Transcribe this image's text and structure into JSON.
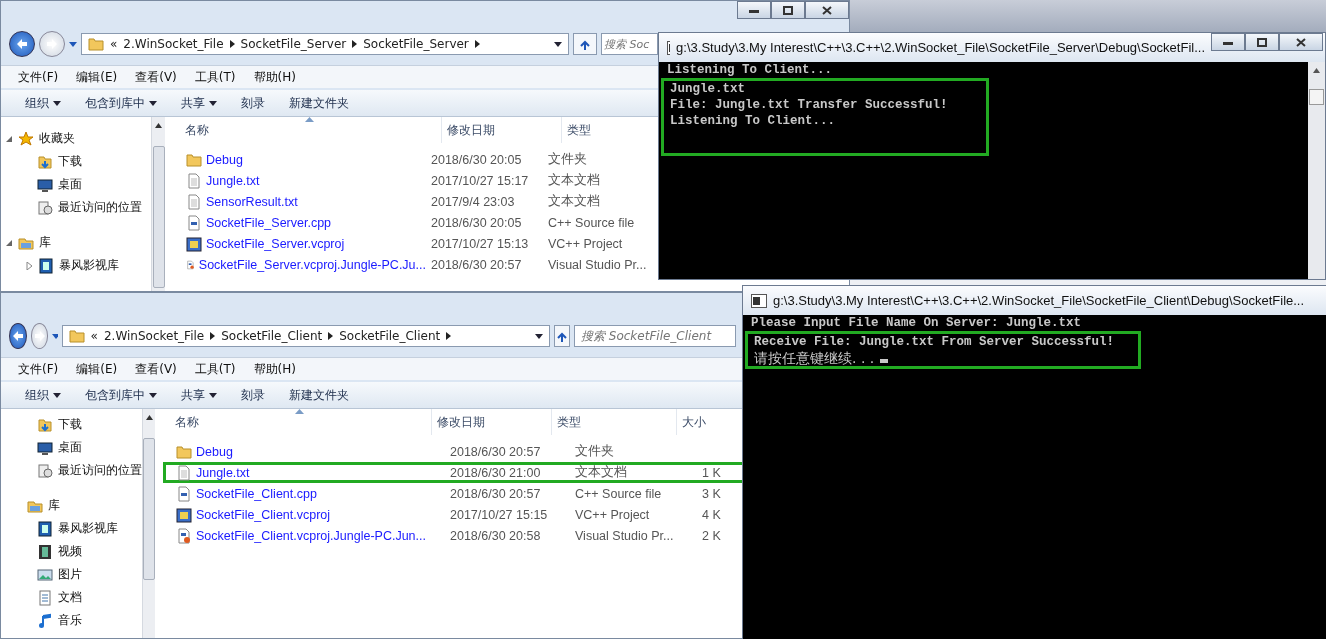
{
  "windows": [
    {
      "kind": "explorer",
      "overflow": "«",
      "breadcrumb": [
        "2.WinSocket_File",
        "SocketFile_Server",
        "SocketFile_Server"
      ],
      "search": {
        "placeholder": "搜索 Soc"
      },
      "menu": [
        "文件(F)",
        "编辑(E)",
        "查看(V)",
        "工具(T)",
        "帮助(H)"
      ],
      "toolbar": [
        {
          "label": "组织",
          "dropdown": true
        },
        {
          "label": "包含到库中",
          "dropdown": true
        },
        {
          "label": "共享",
          "dropdown": true
        },
        {
          "label": "刻录",
          "dropdown": false
        },
        {
          "label": "新建文件夹",
          "dropdown": false
        }
      ],
      "nav": [
        {
          "label": "收藏夹",
          "kind": "favorites",
          "expanded": true,
          "children": [
            {
              "label": "下载",
              "kind": "download"
            },
            {
              "label": "桌面",
              "kind": "desktop"
            },
            {
              "label": "最近访问的位置",
              "kind": "recent"
            }
          ]
        },
        {
          "label": "库",
          "kind": "library",
          "expanded": true,
          "children": [
            {
              "label": "暴风影视库",
              "kind": "media",
              "expanded": false
            }
          ]
        }
      ],
      "columns": [
        "名称",
        "修改日期",
        "类型"
      ],
      "rows": [
        {
          "name": "Debug",
          "kind": "folder",
          "date": "2018/6/30 20:05",
          "type": "文件夹",
          "highlighted": false
        },
        {
          "name": "Jungle.txt",
          "kind": "text",
          "date": "2017/10/27 15:17",
          "type": "文本文档",
          "highlighted": false
        },
        {
          "name": "SensorResult.txt",
          "kind": "text",
          "date": "2017/9/4 23:03",
          "type": "文本文档",
          "highlighted": false
        },
        {
          "name": "SocketFile_Server.cpp",
          "kind": "cpp",
          "date": "2018/6/30 20:05",
          "type": "C++ Source file",
          "highlighted": false
        },
        {
          "name": "SocketFile_Server.vcproj",
          "kind": "project",
          "date": "2017/10/27 15:13",
          "type": "VC++ Project",
          "highlighted": false
        },
        {
          "name": "SocketFile_Server.vcproj.Jungle-PC.Ju...",
          "kind": "user",
          "date": "2018/6/30 20:57",
          "type": "Visual Studio Pr...",
          "highlighted": false
        }
      ]
    },
    {
      "kind": "console",
      "title": "g:\\3.Study\\3.My Interest\\C++\\3.C++\\2.WinSocket_File\\SocketFile_Server\\Debug\\SocketFil...",
      "lines": [
        {
          "text": "Listening To Client...",
          "highlighted": false
        },
        {
          "text": "Jungle.txt",
          "highlighted": true
        },
        {
          "text": "File: Jungle.txt Transfer Successful!",
          "highlighted": true
        },
        {
          "text": "Listening To Client...",
          "highlighted": true
        }
      ]
    },
    {
      "kind": "explorer",
      "overflow": "«",
      "breadcrumb": [
        "2.WinSocket_File",
        "SocketFile_Client",
        "SocketFile_Client"
      ],
      "search": {
        "placeholder": "搜索 SocketFile_Client"
      },
      "menu": [
        "文件(F)",
        "编辑(E)",
        "查看(V)",
        "工具(T)",
        "帮助(H)"
      ],
      "toolbar": [
        {
          "label": "组织",
          "dropdown": true
        },
        {
          "label": "包含到库中",
          "dropdown": true
        },
        {
          "label": "共享",
          "dropdown": true
        },
        {
          "label": "刻录",
          "dropdown": false
        },
        {
          "label": "新建文件夹",
          "dropdown": false
        }
      ],
      "nav": [
        {
          "children": [
            {
              "label": "下载",
              "kind": "download"
            },
            {
              "label": "桌面",
              "kind": "desktop"
            },
            {
              "label": "最近访问的位置",
              "kind": "recent"
            }
          ]
        },
        {
          "label": "库",
          "kind": "library",
          "children": [
            {
              "label": "暴风影视库",
              "kind": "media"
            },
            {
              "label": "视频",
              "kind": "video"
            },
            {
              "label": "图片",
              "kind": "pictures"
            },
            {
              "label": "文档",
              "kind": "docs"
            },
            {
              "label": "音乐",
              "kind": "music"
            }
          ]
        }
      ],
      "columns": [
        "名称",
        "修改日期",
        "类型",
        "大小"
      ],
      "rows": [
        {
          "name": "Debug",
          "kind": "folder",
          "date": "2018/6/30 20:57",
          "type": "文件夹",
          "highlighted": false
        },
        {
          "name": "Jungle.txt",
          "kind": "text",
          "date": "2018/6/30 21:00",
          "type": "文本文档",
          "size": "1 K",
          "highlighted": true
        },
        {
          "name": "SocketFile_Client.cpp",
          "kind": "cpp",
          "date": "2018/6/30 20:57",
          "type": "C++ Source file",
          "size": "3 K",
          "highlighted": false
        },
        {
          "name": "SocketFile_Client.vcproj",
          "kind": "project",
          "date": "2017/10/27 15:15",
          "type": "VC++ Project",
          "size": "4 K",
          "highlighted": false
        },
        {
          "name": "SocketFile_Client.vcproj.Jungle-PC.Jun...",
          "kind": "user",
          "date": "2018/6/30 20:58",
          "type": "Visual Studio Pr...",
          "size": "2 K",
          "highlighted": false
        }
      ]
    },
    {
      "kind": "console",
      "title": "g:\\3.Study\\3.My Interest\\C++\\3.C++\\2.WinSocket_File\\SocketFile_Client\\Debug\\SocketFile...",
      "lines": [
        {
          "text": "Please Input File Name On Server: Jungle.txt",
          "highlighted": false
        },
        {
          "text": "Receive File: Jungle.txt From Server Successful!",
          "highlighted": true
        },
        {
          "text": "请按任意键继续. . .",
          "highlighted": true
        }
      ],
      "cursor": true
    }
  ]
}
